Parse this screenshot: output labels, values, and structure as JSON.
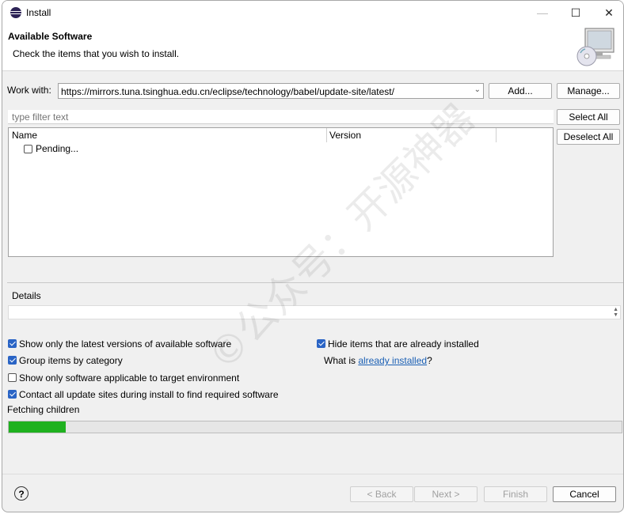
{
  "window": {
    "title": "Install",
    "minimize_label": "—",
    "maximize_label": "☐",
    "close_label": "✕"
  },
  "header": {
    "title": "Available Software",
    "subtitle": "Check the items that you wish to install."
  },
  "work_with": {
    "label": "Work with:",
    "value": "https://mirrors.tuna.tsinghua.edu.cn/eclipse/technology/babel/update-site/latest/",
    "add_label": "Add...",
    "manage_label": "Manage..."
  },
  "filter": {
    "placeholder": "type filter text"
  },
  "buttons": {
    "select_all": "Select All",
    "deselect_all": "Deselect All"
  },
  "table": {
    "columns": [
      "Name",
      "Version"
    ],
    "rows": [
      {
        "name": "Pending...",
        "checked": false
      }
    ]
  },
  "details": {
    "label": "Details"
  },
  "options": {
    "show_latest": {
      "label": "Show only the latest versions of available software",
      "checked": true
    },
    "group_by_category": {
      "label": "Group items by category",
      "checked": true
    },
    "applicable_only": {
      "label": "Show only software applicable to target environment",
      "checked": false
    },
    "contact_all": {
      "label": "Contact all update sites during install to find required software",
      "checked": true
    },
    "hide_installed": {
      "label": "Hide items that are already installed",
      "checked": true
    },
    "what_is_prefix": "What is ",
    "what_is_link": "already installed",
    "what_is_suffix": "?"
  },
  "status": {
    "text": "Fetching children",
    "progress_fraction": 0.093
  },
  "footer": {
    "help_label": "?",
    "back_label": "< Back",
    "next_label": "Next >",
    "finish_label": "Finish",
    "cancel_label": "Cancel"
  },
  "watermark": "©公众号：开源神器",
  "colors": {
    "progress_fill": "#1fb11f",
    "checkbox_on": "#2a64c5",
    "link": "#1a5fb4"
  }
}
